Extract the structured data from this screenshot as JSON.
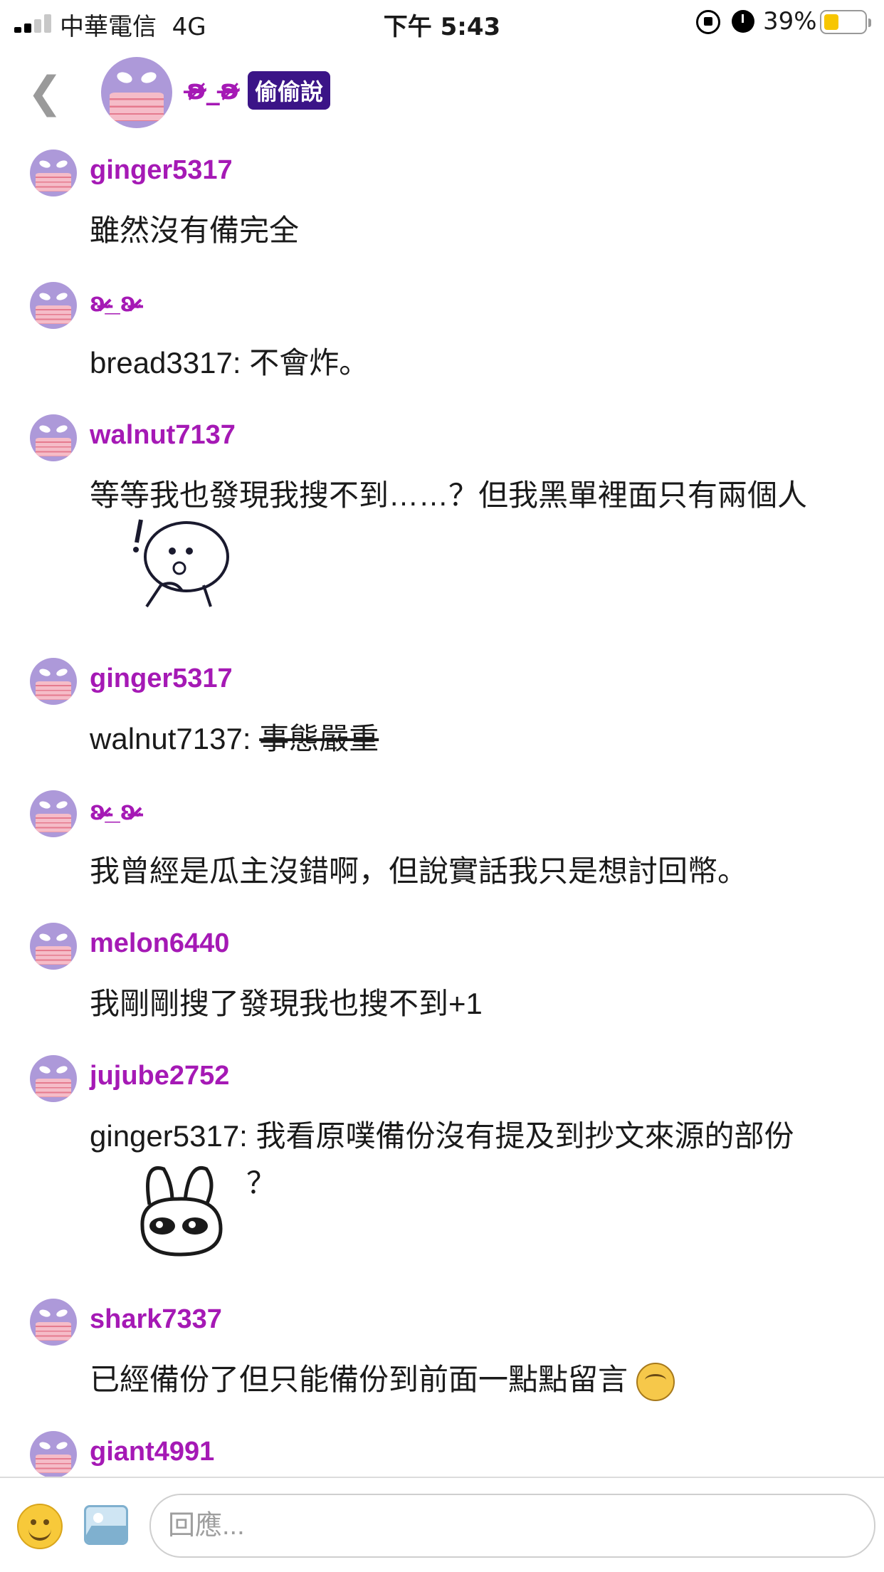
{
  "status_bar": {
    "carrier": "中華電信",
    "network": "4G",
    "time": "下午 5:43",
    "battery_percent": "39%",
    "battery_level": 0.39,
    "signal_bars": 2
  },
  "header": {
    "title": "ʚ̴̶̷̷_ʚ̴̶̷̷",
    "badge": "偷偷說",
    "back_icon": "chevron-left-icon"
  },
  "comments": [
    {
      "user": "ginger5317",
      "text": "雖然沒有備完全"
    },
    {
      "user": "ʚ̴̶̷̷_ʚ̴̶̷̷",
      "text": "bread3317: 不會炸。"
    },
    {
      "user": "walnut7137",
      "text": "等等我也發現我搜不到……？但我黑單裡面只有兩個人",
      "sticker": "thinking-face-sticker"
    },
    {
      "user": "ginger5317",
      "prefix": "walnut7137: ",
      "struck": "事態嚴重"
    },
    {
      "user": "ʚ̴̶̷̷_ʚ̴̶̷̷",
      "text": "我曾經是瓜主沒錯啊，但說實話我只是想討回幣。"
    },
    {
      "user": "melon6440",
      "text": "我剛剛搜了發現我也搜不到+1"
    },
    {
      "user": "jujube2752",
      "text": "ginger5317: 我看原噗備份沒有提及到抄文來源的部份",
      "suffix": "？",
      "sticker": "bunny-sticker"
    },
    {
      "user": "shark7337",
      "text": "已經備份了但只能備份到前面一點點留言",
      "emoji": "worried-emoji"
    },
    {
      "user": "giant4991"
    }
  ],
  "reply_bar": {
    "placeholder": "回應...",
    "emoji_icon": "smiley-icon",
    "image_icon": "image-icon"
  },
  "colors": {
    "username": "#a519b5",
    "badge_bg": "#3b1487",
    "avatar_bg": "#ad99d9",
    "mask": "#f5bcc8"
  }
}
